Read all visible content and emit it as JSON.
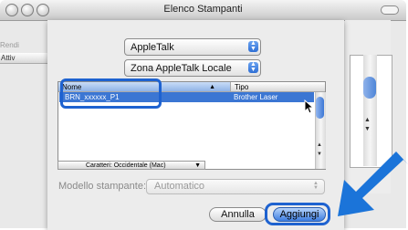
{
  "window": {
    "title": "Elenco Stampanti"
  },
  "background": {
    "toolbar_label": "Rendi",
    "tab_label": "Attiv"
  },
  "sheet": {
    "protocol_popup": {
      "value": "AppleTalk",
      "stepper": "▲▼"
    },
    "zone_popup": {
      "value": "Zona AppleTalk Locale",
      "stepper": "▲▼"
    },
    "list": {
      "columns": [
        "Nome",
        "Tipo"
      ],
      "rows": [
        {
          "name": "BRN_xxxxxx_P1",
          "type": "Brother Laser"
        }
      ]
    },
    "charset_popup": {
      "value": "Caratteri: Occidentale (Mac)"
    },
    "model_label": "Modello stampante:",
    "model_popup": {
      "value": "Automatico"
    },
    "cancel_label": "Annulla",
    "add_label": "Aggiungi"
  },
  "colors": {
    "highlight": "#1e62d0",
    "selection": "#3b76d3",
    "arrow": "#1b74d9"
  }
}
